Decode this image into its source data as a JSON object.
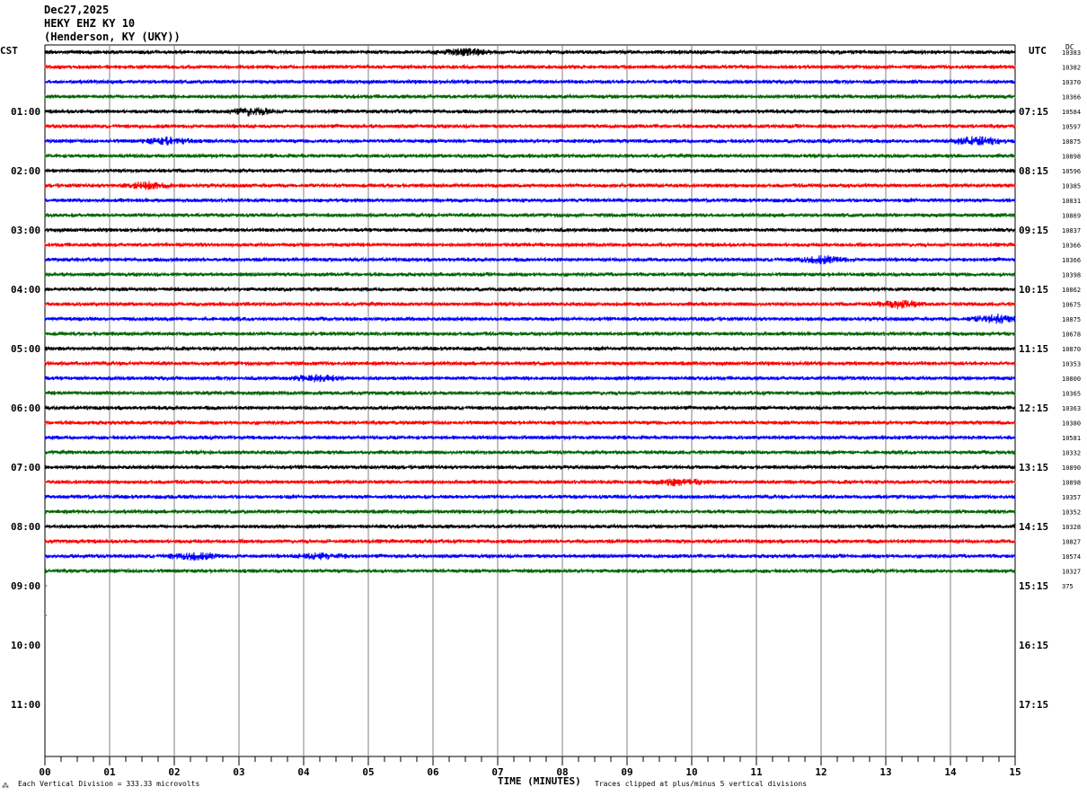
{
  "header": {
    "date": "Dec27,2025",
    "station": "HEKY EHZ KY 10",
    "location": "(Henderson, KY (UKY))"
  },
  "labels": {
    "left_tz": "CST",
    "right_tz": "UTC",
    "dc": "DC"
  },
  "footer": {
    "scale_note": "Each Vertical Division =  333.33 microvolts",
    "xlabel": "TIME (MINUTES)",
    "clip_note": "Traces clipped at plus/minus 5 vertical divisions"
  },
  "colors": {
    "trace_cycle": [
      "#000000",
      "#ff0000",
      "#0000ff",
      "#006400"
    ],
    "grid": "#808080"
  },
  "chart_data": {
    "type": "line",
    "title": "Dec27,2025 HEKY EHZ KY 10 (Henderson, KY (UKY))",
    "xlabel": "TIME (MINUTES)",
    "xlim": [
      0,
      15
    ],
    "x_ticks": [
      "00",
      "01",
      "02",
      "03",
      "04",
      "05",
      "06",
      "07",
      "08",
      "09",
      "10",
      "11",
      "12",
      "13",
      "14",
      "15"
    ],
    "rows_total": 48,
    "rows_with_data": 36,
    "hour_labels_cst": [
      "01:00",
      "02:00",
      "03:00",
      "04:00",
      "05:00",
      "06:00",
      "07:00",
      "08:00",
      "09:00",
      "10:00",
      "11:00"
    ],
    "hour_labels_utc": [
      "07:15",
      "08:15",
      "09:15",
      "10:15",
      "11:15",
      "12:15",
      "13:15",
      "14:15",
      "15:15",
      "16:15",
      "17:15"
    ],
    "dc_offsets": [
      "10383",
      "10382",
      "10370",
      "10366",
      "10584",
      "10597",
      "10875",
      "10898",
      "10596",
      "10385",
      "10831",
      "10869",
      "10837",
      "10366",
      "10366",
      "10398",
      "10862",
      "10675",
      "10875",
      "10678",
      "10870",
      "10353",
      "10800",
      "10365",
      "10363",
      "10380",
      "10581",
      "10332",
      "10890",
      "10898",
      "10357",
      "10352",
      "10328",
      "10827",
      "10574",
      "10327",
      "375"
    ],
    "scale_microvolts_per_division": 333.33,
    "clip_divisions": 5,
    "bursts": [
      {
        "row": 0,
        "minute": 6.5,
        "amplitude": 1.5
      },
      {
        "row": 4,
        "minute": 3.2,
        "amplitude": 1.6
      },
      {
        "row": 6,
        "minute": 14.4,
        "amplitude": 2.0
      },
      {
        "row": 6,
        "minute": 1.9,
        "amplitude": 1.5
      },
      {
        "row": 9,
        "minute": 1.6,
        "amplitude": 1.4
      },
      {
        "row": 14,
        "minute": 12.0,
        "amplitude": 1.5
      },
      {
        "row": 17,
        "minute": 13.2,
        "amplitude": 1.6
      },
      {
        "row": 18,
        "minute": 14.7,
        "amplitude": 1.8
      },
      {
        "row": 22,
        "minute": 4.2,
        "amplitude": 1.3
      },
      {
        "row": 29,
        "minute": 9.8,
        "amplitude": 1.5
      },
      {
        "row": 34,
        "minute": 2.3,
        "amplitude": 1.5
      },
      {
        "row": 34,
        "minute": 4.3,
        "amplitude": 1.3
      }
    ]
  }
}
